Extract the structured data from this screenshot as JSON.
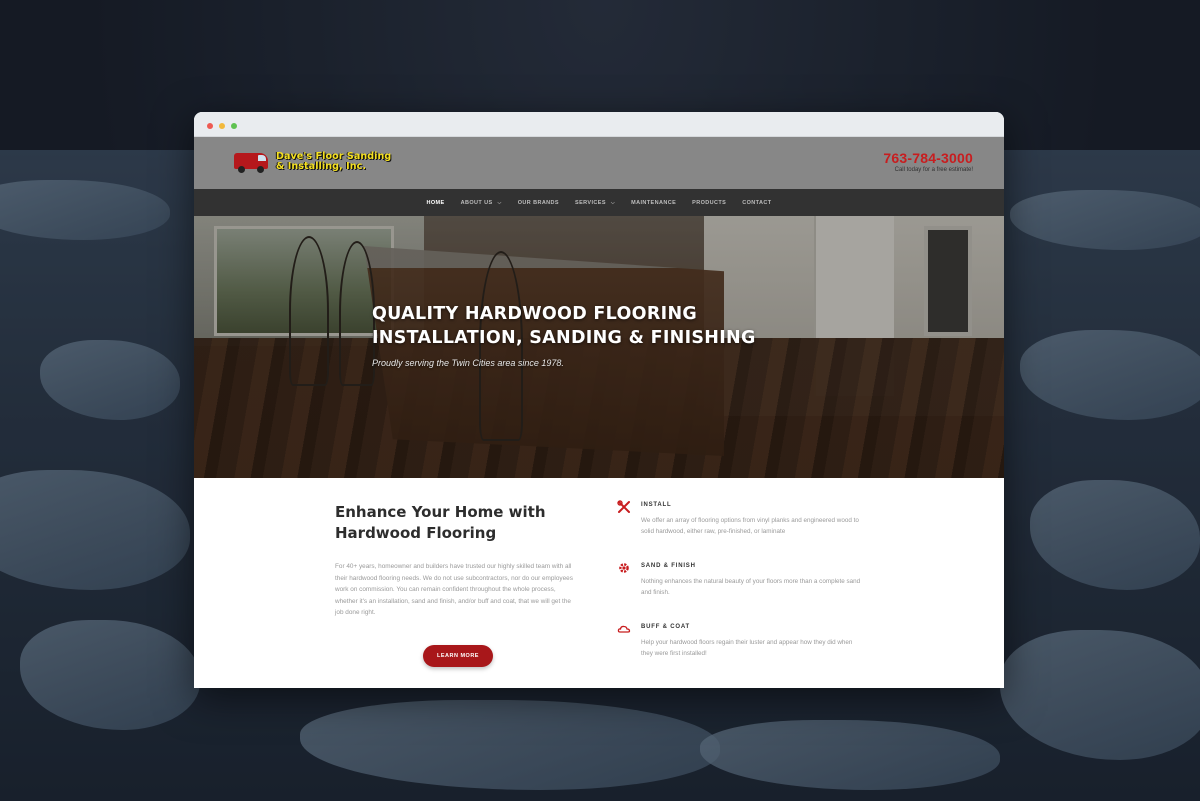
{
  "site": {
    "logo_line1": "Dave's Floor Sanding",
    "logo_line2": "& Installing, Inc.",
    "phone": "763-784-3000",
    "phone_sub": "Call today for a free estimate!"
  },
  "nav": {
    "items": [
      {
        "label": "HOME",
        "active": true
      },
      {
        "label": "ABOUT US",
        "has_caret": true
      },
      {
        "label": "OUR BRANDS"
      },
      {
        "label": "SERVICES",
        "has_caret": true
      },
      {
        "label": "MAINTENANCE"
      },
      {
        "label": "PRODUCTS"
      },
      {
        "label": "CONTACT"
      }
    ]
  },
  "hero": {
    "title_line1": "QUALITY HARDWOOD FLOORING",
    "title_line2": "INSTALLATION, SANDING & FINISHING",
    "subtitle": "Proudly serving the Twin Cities area since 1978."
  },
  "intro": {
    "heading_line1": "Enhance Your Home with",
    "heading_line2": "Hardwood Flooring",
    "body": "For 40+ years, homeowner and builders have trusted our highly skilled team with all their hardwood flooring needs. We do not use subcontractors, nor do our employees work on commission. You can remain confident throughout the whole process, whether it's an installation, sand and finish, and/or buff and coat, that we will get the job done right.",
    "button": "LEARN MORE"
  },
  "features": [
    {
      "icon": "tools-icon",
      "title": "INSTALL",
      "desc": "We offer an array of flooring options from vinyl planks and engineered wood to solid hardwood, either raw, pre-finished, or laminate"
    },
    {
      "icon": "gear-icon",
      "title": "SAND & FINISH",
      "desc": "Nothing enhances the natural beauty of your floors more than a complete sand and finish."
    },
    {
      "icon": "cloud-icon",
      "title": "BUFF & COAT",
      "desc": "Help your hardwood floors regain their luster and appear how they did when they were first installed!"
    }
  ],
  "colors": {
    "accent_red": "#c81d1f",
    "button_red": "#a8171a",
    "header_gray": "#878787",
    "nav_dark": "#323232",
    "logo_yellow": "#f5e022"
  }
}
